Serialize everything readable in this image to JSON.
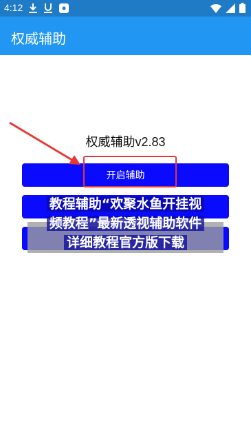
{
  "status_bar": {
    "time": "4:12",
    "left_icons": [
      "download-icon",
      "underline-icon",
      "app-square-icon"
    ],
    "right_icons": [
      "wifi-icon",
      "signal-icon",
      "battery-icon"
    ]
  },
  "app_bar": {
    "title": "权威辅助"
  },
  "main": {
    "version_text": "权威辅助v2.83",
    "buttons": [
      {
        "label": "开启辅助"
      },
      {
        "label": ""
      },
      {
        "label": ""
      }
    ]
  },
  "overlay": {
    "banner_lines": [
      "教程辅助“欢聚水鱼开挂视",
      "频教程”最新透视辅助软件",
      "详细教程官方版下载"
    ]
  },
  "colors": {
    "status_bar": "#1f7bc6",
    "app_bar": "#2196f3",
    "button": "#0a0aff",
    "annotation": "#e53935"
  }
}
